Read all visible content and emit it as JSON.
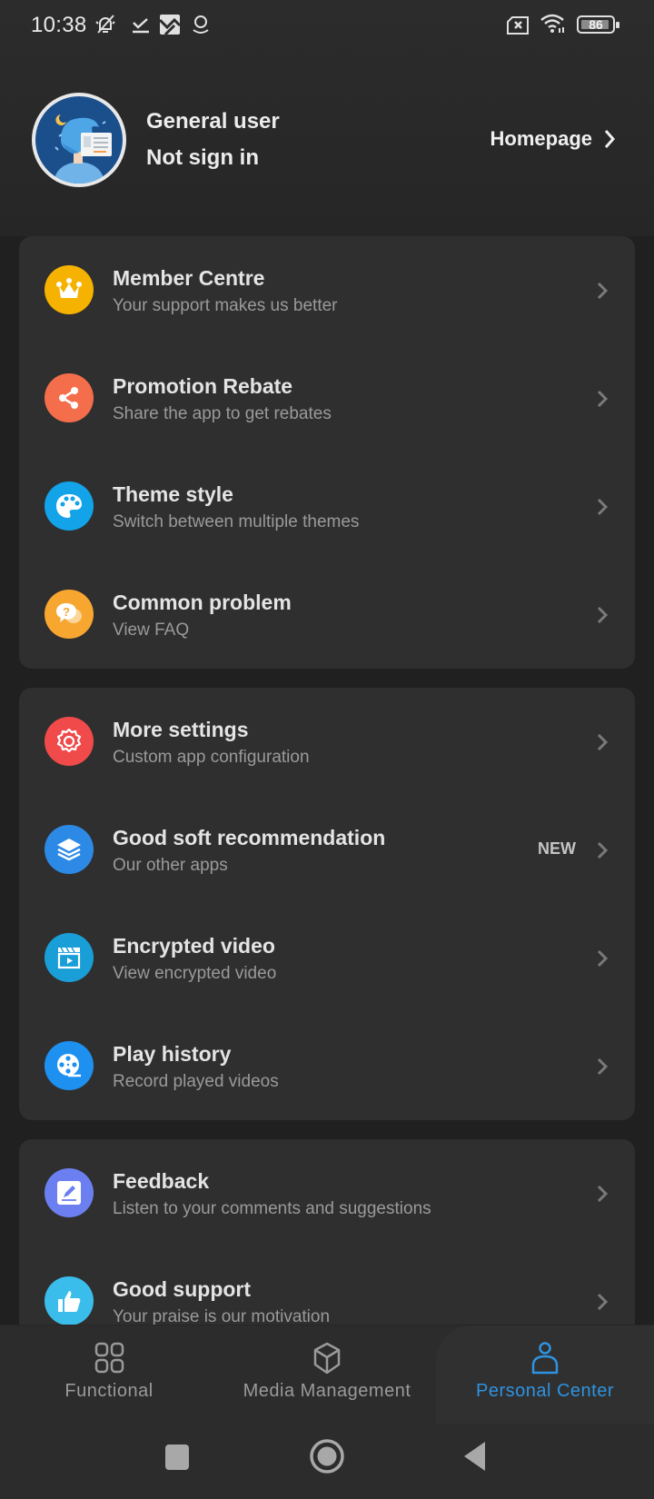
{
  "status_bar": {
    "time": "10:38",
    "icons": [
      "bell-off-icon",
      "download-done-icon",
      "photo-download-icon",
      "location-icon"
    ],
    "right_icons": [
      "sim-error-icon",
      "wifi-icon",
      "battery-icon"
    ],
    "battery_level": "86"
  },
  "profile": {
    "name": "General user",
    "status": "Not sign in",
    "homepage_label": "Homepage"
  },
  "cards": [
    {
      "items": [
        {
          "icon": "crown-icon",
          "color": "#f5b200",
          "title": "Member Centre",
          "subtitle": "Your support makes us better"
        },
        {
          "icon": "share-icon",
          "color": "#f46e4c",
          "title": "Promotion Rebate",
          "subtitle": "Share the app to get rebates"
        },
        {
          "icon": "palette-icon",
          "color": "#12a3e8",
          "title": "Theme style",
          "subtitle": "Switch between multiple themes"
        },
        {
          "icon": "faq-icon",
          "color": "#f7a630",
          "title": "Common problem",
          "subtitle": "View FAQ"
        }
      ]
    },
    {
      "items": [
        {
          "icon": "gear-icon",
          "color": "#f04a4a",
          "title": "More settings",
          "subtitle": "Custom app configuration"
        },
        {
          "icon": "layers-icon",
          "color": "#2c8ae6",
          "title": "Good soft recommendation",
          "subtitle": "Our other apps",
          "badge": "NEW"
        },
        {
          "icon": "clapper-icon",
          "color": "#1a9ed8",
          "title": "Encrypted video",
          "subtitle": "View encrypted video"
        },
        {
          "icon": "film-reel-icon",
          "color": "#1e90f0",
          "title": "Play history",
          "subtitle": "Record played videos"
        }
      ]
    },
    {
      "items": [
        {
          "icon": "edit-icon",
          "color": "#6b7ff0",
          "title": "Feedback",
          "subtitle": "Listen to your comments and suggestions"
        },
        {
          "icon": "thumbs-up-icon",
          "color": "#3bbdec",
          "title": "Good support",
          "subtitle": "Your praise is our motivation"
        }
      ]
    }
  ],
  "bottom_nav": {
    "tabs": [
      {
        "label": "Functional",
        "icon": "grid-icon",
        "active": false
      },
      {
        "label": "Media Management",
        "icon": "cube-icon",
        "active": false
      },
      {
        "label": "Personal Center",
        "icon": "person-icon",
        "active": true
      }
    ],
    "active_color": "#2e93e0"
  },
  "system_nav": [
    "recents-button",
    "home-button",
    "back-button"
  ]
}
